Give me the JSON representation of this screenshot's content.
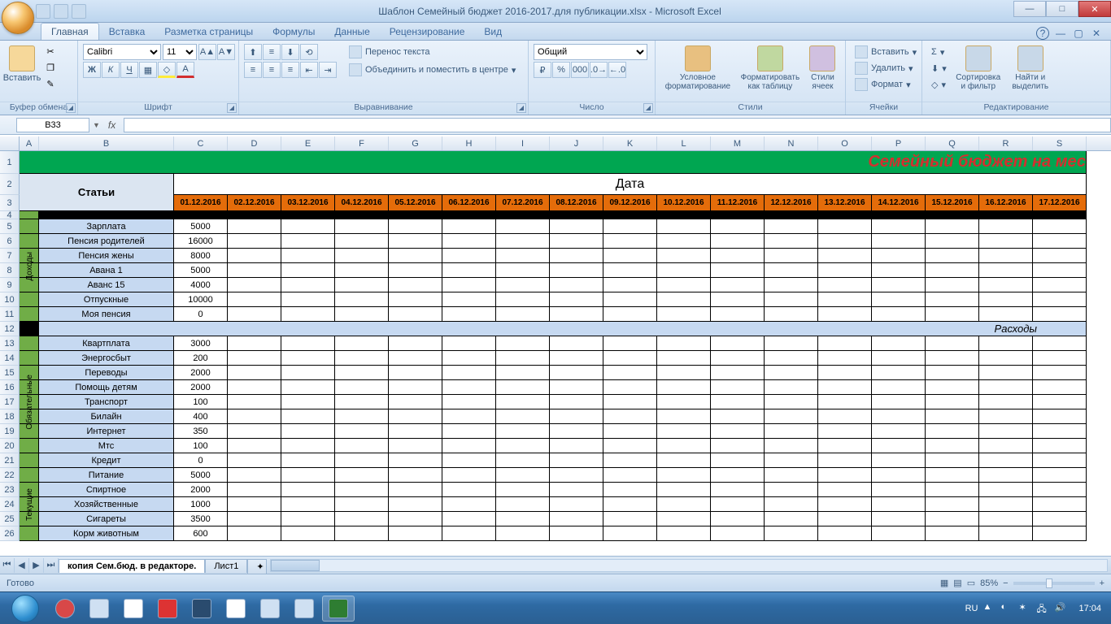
{
  "window": {
    "title": "Шаблон Семейный бюджет 2016-2017.для публикации.xlsx - Microsoft Excel"
  },
  "tabs": {
    "home": "Главная",
    "insert": "Вставка",
    "layout": "Разметка страницы",
    "formulas": "Формулы",
    "data": "Данные",
    "review": "Рецензирование",
    "view": "Вид"
  },
  "ribbon": {
    "clipboard": {
      "paste": "Вставить",
      "label": "Буфер обмена"
    },
    "font": {
      "name": "Calibri",
      "size": "11",
      "label": "Шрифт"
    },
    "alignment": {
      "wrap": "Перенос текста",
      "merge": "Объединить и поместить в центре",
      "label": "Выравнивание"
    },
    "number": {
      "format": "Общий",
      "label": "Число"
    },
    "styles": {
      "cond": "Условное форматирование",
      "table": "Форматировать как таблицу",
      "cell": "Стили ячеек",
      "label": "Стили"
    },
    "cells": {
      "insert": "Вставить",
      "delete": "Удалить",
      "format": "Формат",
      "label": "Ячейки"
    },
    "editing": {
      "sort": "Сортировка и фильтр",
      "find": "Найти и выделить",
      "label": "Редактирование"
    }
  },
  "namebox": "B33",
  "columns": [
    "A",
    "B",
    "C",
    "D",
    "E",
    "F",
    "G",
    "H",
    "I",
    "J",
    "K",
    "L",
    "M",
    "N",
    "O",
    "P",
    "Q",
    "R",
    "S"
  ],
  "row_numbers": [
    "1",
    "2",
    "3",
    "4",
    "5",
    "6",
    "7",
    "8",
    "9",
    "10",
    "11",
    "12",
    "13",
    "14",
    "15",
    "16",
    "17",
    "18",
    "19",
    "20",
    "21",
    "22",
    "23",
    "24",
    "25",
    "26"
  ],
  "banner": "Семейный бюджет на мес",
  "header2_label": "Статьи",
  "header2_right": "Дата",
  "dates": [
    "01.12.2016",
    "02.12.2016",
    "03.12.2016",
    "04.12.2016",
    "05.12.2016",
    "06.12.2016",
    "07.12.2016",
    "08.12.2016",
    "09.12.2016",
    "10.12.2016",
    "11.12.2016",
    "12.12.2016",
    "13.12.2016",
    "14.12.2016",
    "15.12.2016",
    "16.12.2016",
    "17.12.2016"
  ],
  "section_income": "Доходы",
  "section_mandatory": "Обязательные",
  "section_current": "Текущие",
  "section_expenses": "Расходы",
  "rows": [
    {
      "r": 5,
      "b": "Зарплата",
      "c": "5000"
    },
    {
      "r": 6,
      "b": "Пенсия родителей",
      "c": "16000"
    },
    {
      "r": 7,
      "b": "Пенсия жены",
      "c": "8000"
    },
    {
      "r": 8,
      "b": "Авана 1",
      "c": "5000"
    },
    {
      "r": 9,
      "b": "Аванс 15",
      "c": "4000"
    },
    {
      "r": 10,
      "b": "Отпускные",
      "c": "10000"
    },
    {
      "r": 11,
      "b": "Моя пенсия",
      "c": "0"
    },
    {
      "r": 13,
      "b": "Квартплата",
      "c": "3000"
    },
    {
      "r": 14,
      "b": "Энергосбыт",
      "c": "200"
    },
    {
      "r": 15,
      "b": "Переводы",
      "c": "2000"
    },
    {
      "r": 16,
      "b": "Помощь детям",
      "c": "2000"
    },
    {
      "r": 17,
      "b": "Транспорт",
      "c": "100"
    },
    {
      "r": 18,
      "b": "Билайн",
      "c": "400"
    },
    {
      "r": 19,
      "b": "Интернет",
      "c": "350"
    },
    {
      "r": 20,
      "b": "Мтс",
      "c": "100"
    },
    {
      "r": 21,
      "b": "Кредит",
      "c": "0"
    },
    {
      "r": 22,
      "b": "Питание",
      "c": "5000"
    },
    {
      "r": 23,
      "b": "Спиртное",
      "c": "2000"
    },
    {
      "r": 24,
      "b": "Хозяйственные",
      "c": "1000"
    },
    {
      "r": 25,
      "b": "Сигареты",
      "c": "3500"
    },
    {
      "r": 26,
      "b": "Корм животным",
      "c": "600"
    }
  ],
  "sheettabs": {
    "s1": "копия Сем.бюд. в редакторе.",
    "s2": "Лист1"
  },
  "status": {
    "ready": "Готово",
    "lang": "RU",
    "zoom": "85%",
    "time": "17:04"
  }
}
